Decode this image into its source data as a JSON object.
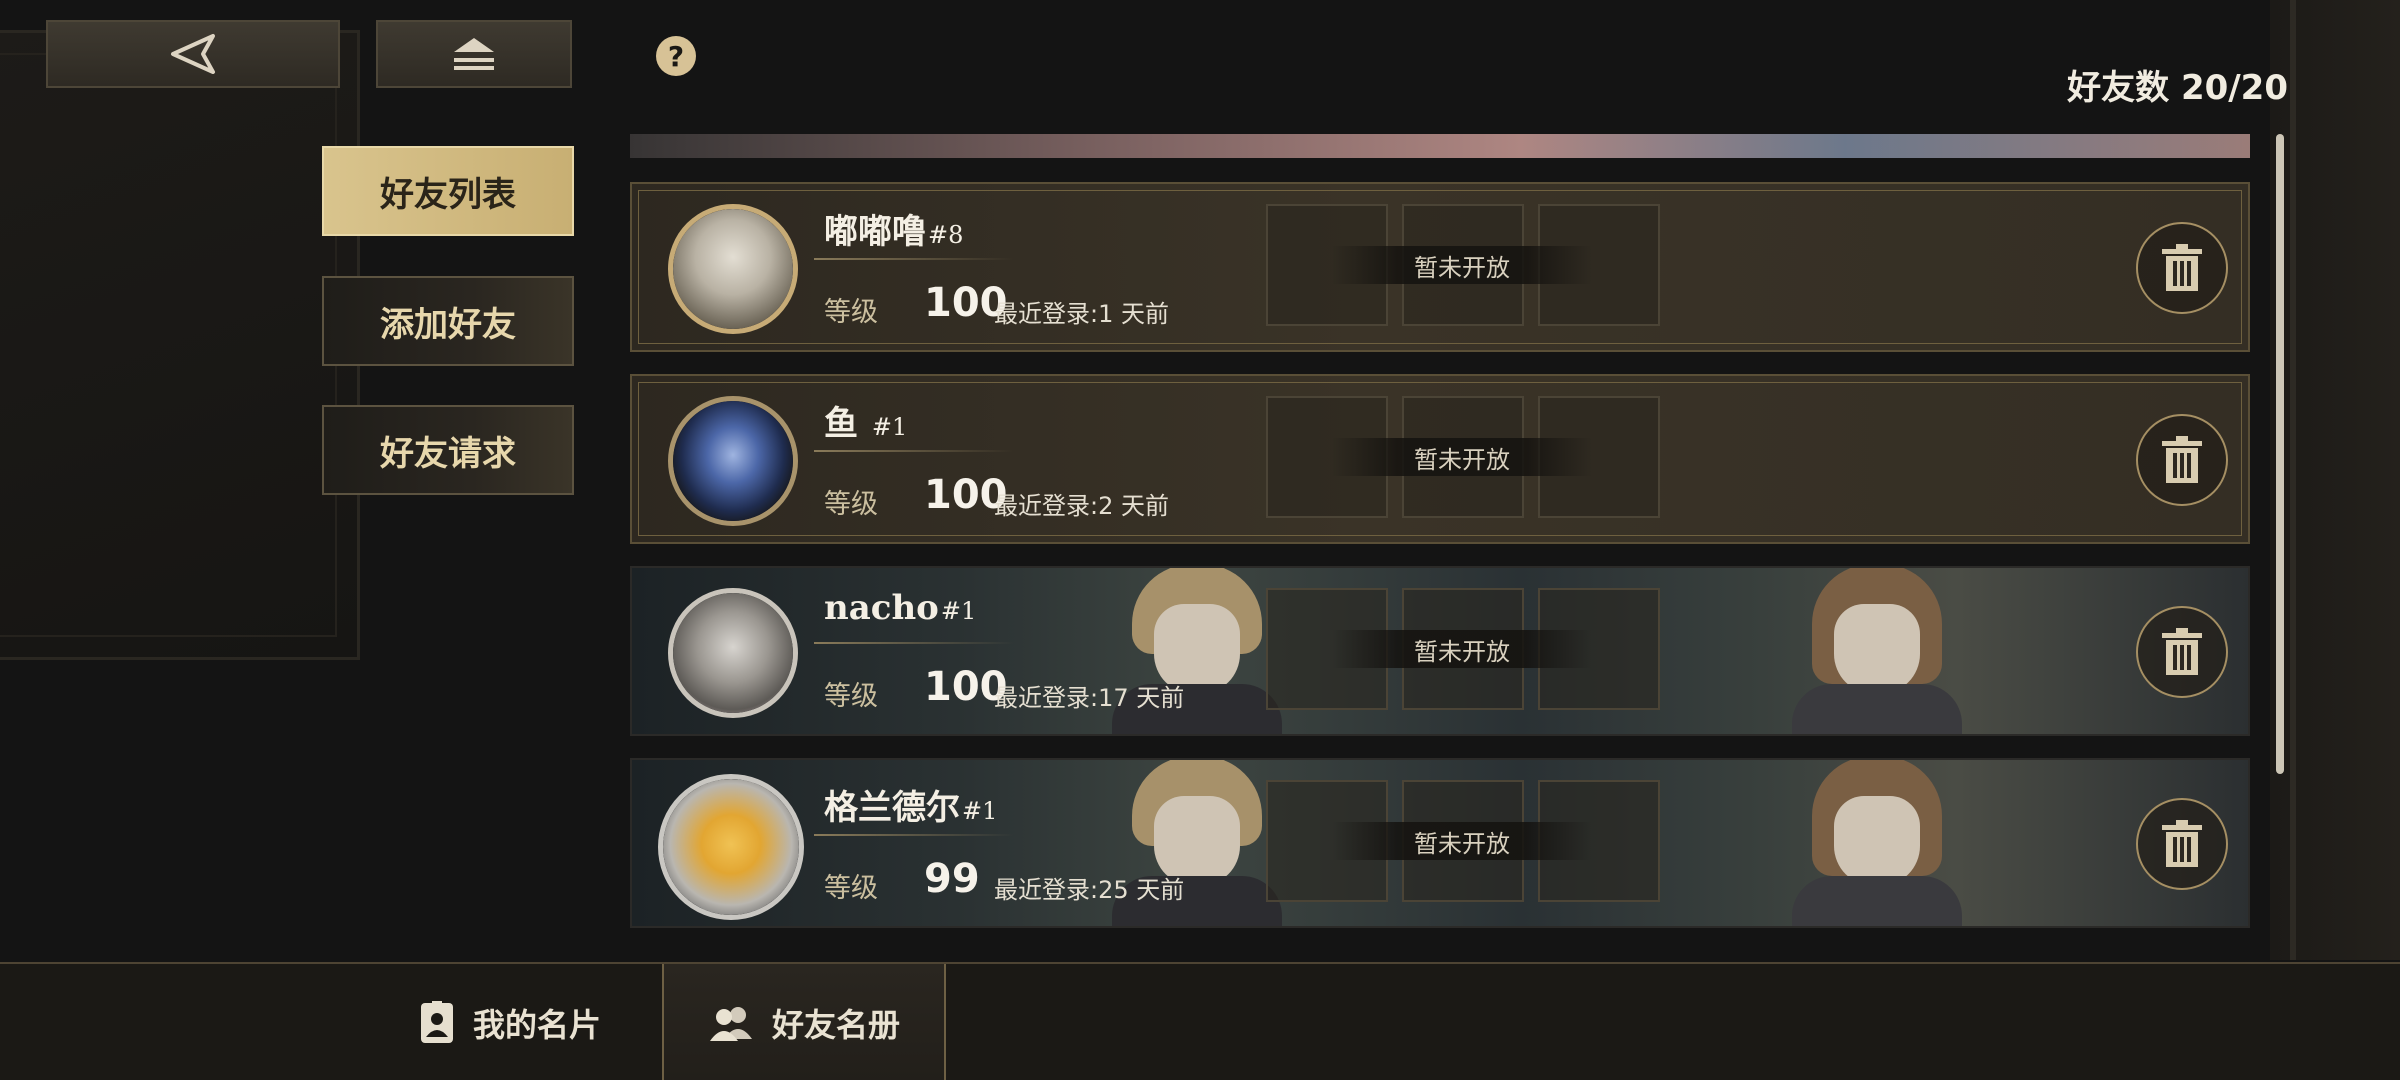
{
  "header": {
    "friend_count_label": "好友数 20/20"
  },
  "side_tabs": [
    {
      "label": "好友列表",
      "active": true
    },
    {
      "label": "添加好友",
      "active": false
    },
    {
      "label": "好友请求",
      "active": false
    }
  ],
  "friends": [
    {
      "name": "嘟嘟噜",
      "tag": "#8",
      "level_label": "等级",
      "level": "100",
      "last_login": "最近登录:1 天前",
      "slot_status": "暂未开放",
      "style": "gold"
    },
    {
      "name": "鱼 ",
      "tag": "#1",
      "level_label": "等级",
      "level": "100",
      "last_login": "最近登录:2 天前",
      "slot_status": "暂未开放",
      "style": "gold"
    },
    {
      "name": "nacho",
      "tag": "#1",
      "level_label": "等级",
      "level": "100",
      "last_login": "最近登录:17 天前",
      "slot_status": "暂未开放",
      "style": "scene"
    },
    {
      "name": "格兰德尔",
      "tag": "#1",
      "level_label": "等级",
      "level": "99",
      "last_login": "最近登录:25 天前",
      "slot_status": "暂未开放",
      "style": "scene"
    }
  ],
  "bottom_nav": [
    {
      "label": "我的名片",
      "icon": "id-card-icon",
      "active": false
    },
    {
      "label": "好友名册",
      "icon": "people-icon",
      "active": true
    }
  ],
  "icons": {
    "back": "back-arrow-icon",
    "home": "home-eject-icon",
    "help": "?",
    "delete": "trash-icon"
  },
  "colors": {
    "accent_gold": "#d9c48d",
    "card_border": "#5a4f37",
    "background": "#141414"
  }
}
